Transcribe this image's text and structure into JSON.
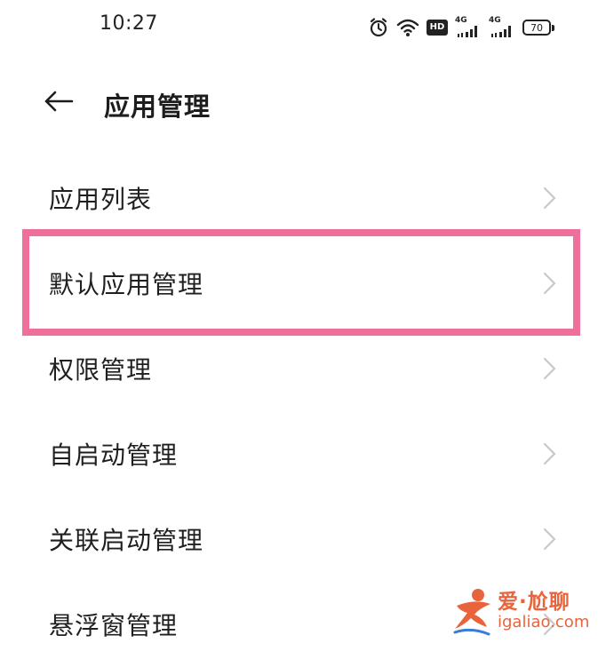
{
  "status_bar": {
    "time": "10:27",
    "icons": [
      "alarm-icon",
      "wifi-icon",
      "hd-icon",
      "signal-4g-icon",
      "signal-4g-icon",
      "battery-icon"
    ],
    "hd_label": "HD",
    "signal_label": "4G",
    "battery_level": "70"
  },
  "header": {
    "back_icon": "arrow-left-icon",
    "title": "应用管理"
  },
  "menu": {
    "items": [
      {
        "label": "应用列表"
      },
      {
        "label": "默认应用管理"
      },
      {
        "label": "权限管理"
      },
      {
        "label": "自启动管理"
      },
      {
        "label": "关联启动管理"
      },
      {
        "label": "悬浮窗管理"
      }
    ],
    "chevron_icon": "chevron-right-icon"
  },
  "annotation": {
    "highlight_color": "#ee6f9b",
    "highlighted_item": "默认应用管理"
  },
  "watermark": {
    "title": "爱·尬聊",
    "url": "igaliao.com",
    "color": "#e8643c"
  }
}
